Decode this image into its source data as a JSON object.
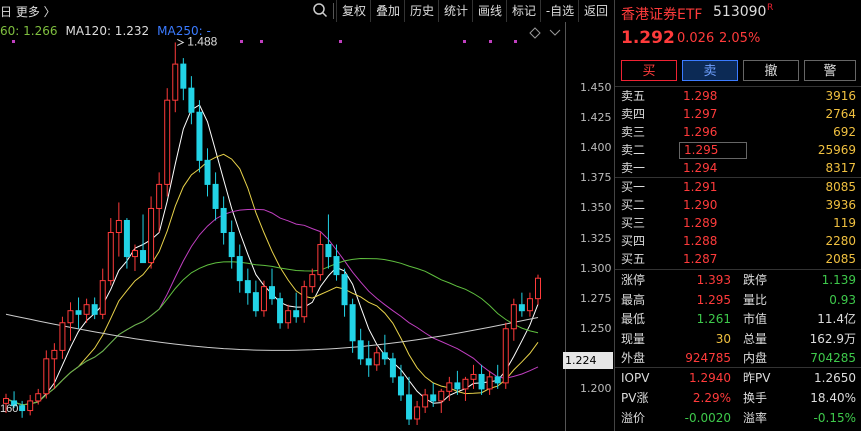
{
  "toolbar": {
    "left_text": "日  更多 〉",
    "buttons": [
      "复权",
      "叠加",
      "历史",
      "统计",
      "画线",
      "标记",
      "-自选",
      "返回"
    ]
  },
  "ma_legend": [
    {
      "text": "60: 1.266",
      "color": "#7fbf3f"
    },
    {
      "text": "MA120: 1.232",
      "color": "#dddddd"
    },
    {
      "text": "MA250: -",
      "color": "#3b7bff"
    }
  ],
  "chart_data": {
    "type": "candlestick",
    "y_ticks": [
      "1.450",
      "1.425",
      "1.400",
      "1.375",
      "1.350",
      "1.325",
      "1.300",
      "1.275",
      "1.250",
      "1.225",
      "1.200"
    ],
    "ylim": [
      1.165,
      1.505
    ],
    "current_price_label": "1.224",
    "annotations": [
      {
        "text": "1.488",
        "price": 1.488
      },
      {
        "text": "160",
        "price": 1.16
      }
    ],
    "candles": [
      [
        1.188,
        1.196,
        1.18,
        1.192
      ],
      [
        1.19,
        1.198,
        1.184,
        1.186
      ],
      [
        1.186,
        1.19,
        1.176,
        1.182
      ],
      [
        1.182,
        1.195,
        1.178,
        1.19
      ],
      [
        1.19,
        1.2,
        1.187,
        1.196
      ],
      [
        1.196,
        1.232,
        1.192,
        1.225
      ],
      [
        1.225,
        1.238,
        1.2,
        1.232
      ],
      [
        1.232,
        1.26,
        1.225,
        1.255
      ],
      [
        1.255,
        1.272,
        1.24,
        1.265
      ],
      [
        1.265,
        1.276,
        1.25,
        1.262
      ],
      [
        1.262,
        1.275,
        1.255,
        1.27
      ],
      [
        1.27,
        1.276,
        1.258,
        1.262
      ],
      [
        1.262,
        1.3,
        1.258,
        1.29
      ],
      [
        1.29,
        1.342,
        1.286,
        1.33
      ],
      [
        1.33,
        1.355,
        1.31,
        1.34
      ],
      [
        1.34,
        1.342,
        1.3,
        1.31
      ],
      [
        1.31,
        1.32,
        1.298,
        1.315
      ],
      [
        1.315,
        1.345,
        1.308,
        1.305
      ],
      [
        1.305,
        1.36,
        1.3,
        1.35
      ],
      [
        1.35,
        1.38,
        1.33,
        1.37
      ],
      [
        1.37,
        1.45,
        1.36,
        1.44
      ],
      [
        1.44,
        1.488,
        1.43,
        1.47
      ],
      [
        1.47,
        1.475,
        1.44,
        1.45
      ],
      [
        1.45,
        1.46,
        1.42,
        1.43
      ],
      [
        1.43,
        1.44,
        1.38,
        1.39
      ],
      [
        1.39,
        1.4,
        1.36,
        1.37
      ],
      [
        1.37,
        1.38,
        1.34,
        1.35
      ],
      [
        1.35,
        1.36,
        1.32,
        1.33
      ],
      [
        1.33,
        1.34,
        1.3,
        1.31
      ],
      [
        1.31,
        1.32,
        1.28,
        1.29
      ],
      [
        1.29,
        1.3,
        1.27,
        1.28
      ],
      [
        1.28,
        1.29,
        1.26,
        1.265
      ],
      [
        1.265,
        1.29,
        1.26,
        1.285
      ],
      [
        1.285,
        1.3,
        1.27,
        1.275
      ],
      [
        1.275,
        1.28,
        1.25,
        1.255
      ],
      [
        1.255,
        1.27,
        1.25,
        1.265
      ],
      [
        1.265,
        1.28,
        1.255,
        1.26
      ],
      [
        1.26,
        1.29,
        1.255,
        1.285
      ],
      [
        1.285,
        1.3,
        1.28,
        1.295
      ],
      [
        1.295,
        1.33,
        1.29,
        1.32
      ],
      [
        1.32,
        1.345,
        1.3,
        1.31
      ],
      [
        1.31,
        1.32,
        1.29,
        1.295
      ],
      [
        1.295,
        1.3,
        1.26,
        1.27
      ],
      [
        1.27,
        1.275,
        1.23,
        1.24
      ],
      [
        1.24,
        1.25,
        1.22,
        1.225
      ],
      [
        1.225,
        1.24,
        1.21,
        1.22
      ],
      [
        1.22,
        1.235,
        1.215,
        1.23
      ],
      [
        1.23,
        1.245,
        1.22,
        1.225
      ],
      [
        1.225,
        1.23,
        1.205,
        1.21
      ],
      [
        1.21,
        1.22,
        1.19,
        1.195
      ],
      [
        1.195,
        1.21,
        1.17,
        1.175
      ],
      [
        1.175,
        1.19,
        1.17,
        1.185
      ],
      [
        1.185,
        1.2,
        1.18,
        1.195
      ],
      [
        1.195,
        1.205,
        1.185,
        1.19
      ],
      [
        1.19,
        1.2,
        1.18,
        1.198
      ],
      [
        1.198,
        1.21,
        1.19,
        1.205
      ],
      [
        1.205,
        1.215,
        1.195,
        1.2
      ],
      [
        1.2,
        1.21,
        1.19,
        1.208
      ],
      [
        1.208,
        1.22,
        1.2,
        1.212
      ],
      [
        1.212,
        1.22,
        1.195,
        1.2
      ],
      [
        1.2,
        1.215,
        1.195,
        1.21
      ],
      [
        1.21,
        1.22,
        1.2,
        1.205
      ],
      [
        1.205,
        1.255,
        1.2,
        1.25
      ],
      [
        1.25,
        1.275,
        1.24,
        1.27
      ],
      [
        1.27,
        1.28,
        1.26,
        1.265
      ],
      [
        1.265,
        1.28,
        1.26,
        1.275
      ],
      [
        1.275,
        1.295,
        1.27,
        1.292
      ]
    ]
  },
  "panel": {
    "title": "香港证券ETF",
    "code": "513090",
    "r_badge": "R",
    "price": "1.292",
    "change": "0.026",
    "pct": "2.05%",
    "buttons": [
      "买",
      "卖",
      "撤",
      "警"
    ],
    "asks": [
      {
        "label": "卖五",
        "price": "1.298",
        "vol": "3916"
      },
      {
        "label": "卖四",
        "price": "1.297",
        "vol": "2764"
      },
      {
        "label": "卖三",
        "price": "1.296",
        "vol": "692"
      },
      {
        "label": "卖二",
        "price": "1.295",
        "vol": "25969"
      },
      {
        "label": "卖一",
        "price": "1.294",
        "vol": "8317"
      }
    ],
    "bids": [
      {
        "label": "买一",
        "price": "1.291",
        "vol": "8085"
      },
      {
        "label": "买二",
        "price": "1.290",
        "vol": "3936"
      },
      {
        "label": "买三",
        "price": "1.289",
        "vol": "119"
      },
      {
        "label": "买四",
        "price": "1.288",
        "vol": "2280"
      },
      {
        "label": "买五",
        "price": "1.287",
        "vol": "2085"
      }
    ],
    "stats": [
      {
        "l1": "涨停",
        "v1": "1.393",
        "c1": "red",
        "l2": "跌停",
        "v2": "1.139",
        "c2": "green"
      },
      {
        "l1": "最高",
        "v1": "1.295",
        "c1": "red",
        "l2": "量比",
        "v2": "0.93",
        "c2": "green"
      },
      {
        "l1": "最低",
        "v1": "1.261",
        "c1": "green",
        "l2": "市值",
        "v2": "11.4亿",
        "c2": "wht"
      },
      {
        "l1": "现量",
        "v1": "30",
        "c1": "yel",
        "l2": "总量",
        "v2": "162.9万",
        "c2": "wht"
      },
      {
        "l1": "外盘",
        "v1": "924785",
        "c1": "red",
        "l2": "内盘",
        "v2": "704285",
        "c2": "green"
      }
    ],
    "extra": [
      {
        "l1": "IOPV",
        "v1": "1.2940",
        "c1": "red",
        "l2": "昨PV",
        "v2": "1.2650",
        "c2": "wht"
      },
      {
        "l1": "PV涨",
        "v1": "2.29%",
        "c1": "red",
        "l2": "换手",
        "v2": "18.40%",
        "c2": "wht"
      },
      {
        "l1": "溢价",
        "v1": "-0.0020",
        "c1": "green",
        "l2": "溢率",
        "v2": "-0.15%",
        "c2": "green"
      }
    ]
  }
}
